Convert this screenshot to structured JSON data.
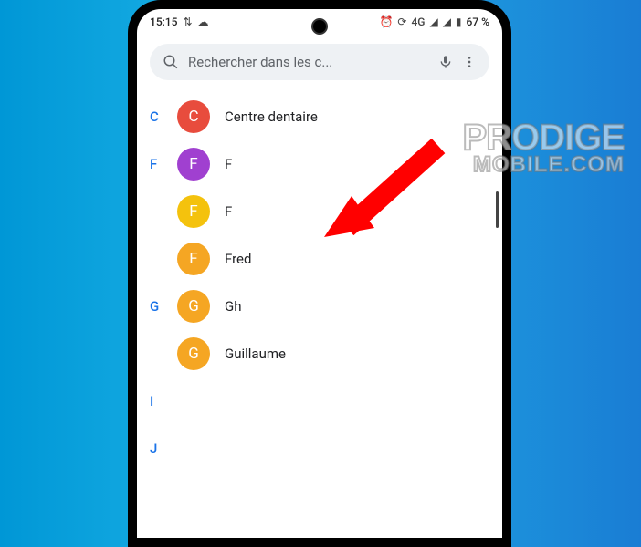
{
  "statusbar": {
    "time": "15:15",
    "network_label": "4G",
    "battery": "67 %"
  },
  "search": {
    "placeholder": "Rechercher dans les c..."
  },
  "sections": [
    {
      "letter": "C",
      "contacts": [
        {
          "initial": "C",
          "name": "Centre dentaire",
          "color": "#e84c3d"
        }
      ]
    },
    {
      "letter": "F",
      "contacts": [
        {
          "initial": "F",
          "name": "F",
          "color": "#a040d0"
        },
        {
          "initial": "F",
          "name": "F",
          "color": "#f4c20d"
        },
        {
          "initial": "F",
          "name": "Fred",
          "color": "#f5a623"
        }
      ]
    },
    {
      "letter": "G",
      "contacts": [
        {
          "initial": "G",
          "name": "Gh",
          "color": "#f5a623"
        },
        {
          "initial": "G",
          "name": "Guillaume",
          "color": "#f5a623"
        }
      ]
    },
    {
      "letter": "I",
      "contacts": []
    },
    {
      "letter": "J",
      "contacts": []
    }
  ],
  "watermark": {
    "line1": "PRODIGE",
    "line2": "MOBILE.COM"
  }
}
